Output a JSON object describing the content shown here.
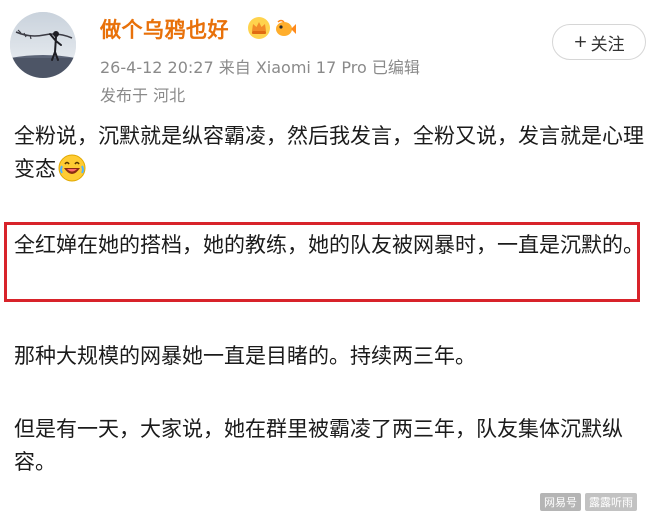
{
  "post": {
    "username": "做个乌鸦也好",
    "meta_line": "26-4-12 20:27  来自 Xiaomi 17 Pro  已编辑",
    "location_line": "发布于 河北",
    "follow_label": "关注",
    "follow_plus": "+",
    "badges": [
      "crown-icon",
      "fish-icon"
    ],
    "username_color": "#e8710a"
  },
  "content": {
    "p1": "全粉说，沉默就是纵容霸凌，然后我发言，全粉又说，发言就是心理变态",
    "p1_emoji": "laughing-emoji",
    "p2": "全红婵在她的搭档，她的教练，她的队友被网暴时，一直是沉默的。",
    "p3": "那种大规模的网暴她一直是目睹的。持续两三年。",
    "p4": "但是有一天，大家说，她在群里被霸凌了两三年，队友集体沉默纵容。",
    "highlight_color": "#d8232a"
  },
  "watermark": {
    "source": "网易号",
    "author": "露露听雨"
  }
}
